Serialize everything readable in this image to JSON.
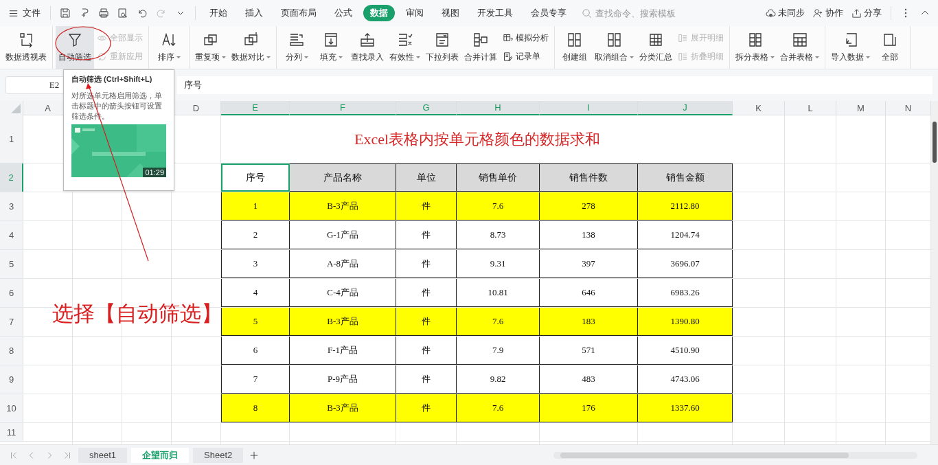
{
  "menu_bar": {
    "file_label": "文件",
    "tabs": [
      {
        "label": "开始",
        "selected": false
      },
      {
        "label": "插入",
        "selected": false
      },
      {
        "label": "页面布局",
        "selected": false
      },
      {
        "label": "公式",
        "selected": false
      },
      {
        "label": "数据",
        "selected": true
      },
      {
        "label": "审阅",
        "selected": false
      },
      {
        "label": "视图",
        "selected": false
      },
      {
        "label": "开发工具",
        "selected": false
      },
      {
        "label": "会员专享",
        "selected": false
      }
    ],
    "search": {
      "placeholder": "查找命令、搜索模板"
    },
    "actions": [
      {
        "label": "未同步"
      },
      {
        "label": "协作"
      },
      {
        "label": "分享"
      }
    ]
  },
  "ribbon": {
    "groups": [
      [
        {
          "kind": "large",
          "label": "数据透视表",
          "dropdown": false,
          "selected": false
        }
      ],
      [
        {
          "kind": "large",
          "label": "自动筛选",
          "dropdown": false,
          "selected": true
        },
        {
          "kind": "stack",
          "items": [
            {
              "label": "全部显示",
              "disabled": true
            },
            {
              "label": "重新应用",
              "disabled": true
            }
          ]
        }
      ],
      [
        {
          "kind": "large",
          "label": "排序",
          "dropdown": true,
          "selected": false
        }
      ],
      [
        {
          "kind": "large",
          "label": "重复项",
          "dropdown": true,
          "selected": false
        },
        {
          "kind": "large",
          "label": "数据对比",
          "dropdown": true,
          "selected": false
        }
      ],
      [
        {
          "kind": "large",
          "label": "分列",
          "dropdown": true,
          "selected": false
        },
        {
          "kind": "large",
          "label": "填充",
          "dropdown": true,
          "selected": false
        },
        {
          "kind": "large",
          "label": "查找录入",
          "dropdown": false,
          "selected": false
        },
        {
          "kind": "large",
          "label": "有效性",
          "dropdown": true,
          "selected": false
        },
        {
          "kind": "large",
          "label": "下拉列表",
          "dropdown": false,
          "selected": false
        },
        {
          "kind": "large",
          "label": "合并计算",
          "dropdown": false,
          "selected": false
        },
        {
          "kind": "stack",
          "items": [
            {
              "label": "模拟分析",
              "disabled": false
            },
            {
              "label": "记录单",
              "disabled": false
            }
          ]
        }
      ],
      [
        {
          "kind": "large",
          "label": "创建组",
          "dropdown": false,
          "selected": false
        },
        {
          "kind": "large",
          "label": "取消组合",
          "dropdown": true,
          "selected": false
        },
        {
          "kind": "large",
          "label": "分类汇总",
          "dropdown": false,
          "selected": false
        },
        {
          "kind": "stack",
          "items": [
            {
              "label": "展开明细",
              "disabled": true
            },
            {
              "label": "折叠明细",
              "disabled": true
            }
          ]
        }
      ],
      [
        {
          "kind": "large",
          "label": "拆分表格",
          "dropdown": true,
          "selected": false
        },
        {
          "kind": "large",
          "label": "合并表格",
          "dropdown": true,
          "selected": false
        }
      ],
      [
        {
          "kind": "large",
          "label": "导入数据",
          "dropdown": true,
          "selected": false
        },
        {
          "kind": "large",
          "label": "全部",
          "dropdown": false,
          "selected": false
        }
      ]
    ]
  },
  "formula_bar": {
    "cell_ref": "E2",
    "content": "序号"
  },
  "tooltip": {
    "title": "自动筛选 (Ctrl+Shift+L)",
    "body": "对所选单元格启用筛选，单击标题中的箭头按钮可设置筛选条件。",
    "video": {
      "duration": "01:29"
    }
  },
  "sheet": {
    "columns": [
      {
        "label": "A",
        "selected": false
      },
      {
        "label": "D",
        "selected": false
      },
      {
        "label": "E",
        "selected": true
      },
      {
        "label": "F",
        "selected": true
      },
      {
        "label": "G",
        "selected": true
      },
      {
        "label": "H",
        "selected": true
      },
      {
        "label": "I",
        "selected": true
      },
      {
        "label": "J",
        "selected": true
      },
      {
        "label": "K",
        "selected": false
      },
      {
        "label": "L",
        "selected": false
      },
      {
        "label": "M",
        "selected": false
      },
      {
        "label": "N",
        "selected": false
      }
    ],
    "rows": [
      {
        "label": "1",
        "selected": false
      },
      {
        "label": "2",
        "selected": true
      },
      {
        "label": "3",
        "selected": false
      },
      {
        "label": "4",
        "selected": false
      },
      {
        "label": "5",
        "selected": false
      },
      {
        "label": "6",
        "selected": false
      },
      {
        "label": "7",
        "selected": false
      },
      {
        "label": "8",
        "selected": false
      },
      {
        "label": "9",
        "selected": false
      },
      {
        "label": "10",
        "selected": false
      },
      {
        "label": "11",
        "selected": false
      }
    ]
  },
  "table": {
    "title": "Excel表格内按单元格颜色的数据求和",
    "header": [
      {
        "label": "序号",
        "selected": true
      },
      {
        "label": "产品名称",
        "selected": false
      },
      {
        "label": "单位",
        "selected": false
      },
      {
        "label": "销售单价",
        "selected": false
      },
      {
        "label": "销售件数",
        "selected": false
      },
      {
        "label": "销售金额",
        "selected": false
      }
    ],
    "rows": [
      {
        "color": "#ffff00",
        "cells": [
          "1",
          "B-3产品",
          "件",
          "7.6",
          "278",
          "2112.80"
        ]
      },
      {
        "color": "#ffffff",
        "cells": [
          "2",
          "G-1产品",
          "件",
          "8.73",
          "138",
          "1204.74"
        ]
      },
      {
        "color": "#ffffff",
        "cells": [
          "3",
          "A-8产品",
          "件",
          "9.31",
          "397",
          "3696.07"
        ]
      },
      {
        "color": "#ffffff",
        "cells": [
          "4",
          "C-4产品",
          "件",
          "10.81",
          "646",
          "6983.26"
        ]
      },
      {
        "color": "#ffff00",
        "cells": [
          "5",
          "B-3产品",
          "件",
          "7.6",
          "183",
          "1390.80"
        ]
      },
      {
        "color": "#ffffff",
        "cells": [
          "6",
          "F-1产品",
          "件",
          "7.9",
          "571",
          "4510.90"
        ]
      },
      {
        "color": "#ffffff",
        "cells": [
          "7",
          "P-9产品",
          "件",
          "9.82",
          "483",
          "4743.06"
        ]
      },
      {
        "color": "#ffff00",
        "cells": [
          "8",
          "B-3产品",
          "件",
          "7.6",
          "176",
          "1337.60"
        ]
      }
    ]
  },
  "annotation": {
    "text": "选择【自动筛选】"
  },
  "sheet_tabs": [
    {
      "label": "sheet1",
      "selected": false
    },
    {
      "label": "企望而归",
      "selected": true
    },
    {
      "label": "Sheet2",
      "selected": false
    }
  ]
}
